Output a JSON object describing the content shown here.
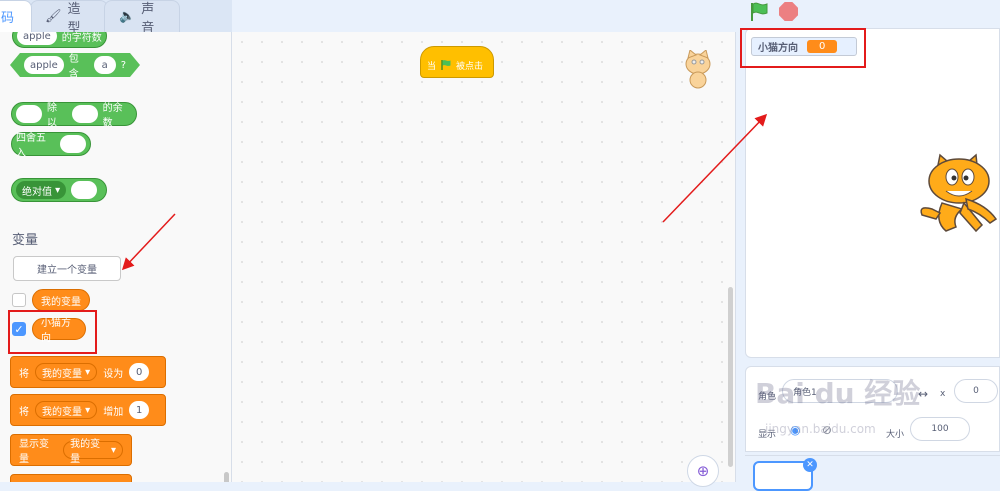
{
  "tabs": {
    "code": "码",
    "costumes": "造型",
    "sounds": "声音"
  },
  "palette": {
    "length_block": {
      "value": "apple",
      "text": "的字符数"
    },
    "contains_block": {
      "value1": "apple",
      "text": "包含",
      "value2": "a",
      "suffix": "?"
    },
    "mod_block": {
      "text1": "除以",
      "text2": "的余数"
    },
    "round_block": {
      "text": "四舍五入"
    },
    "abs_block": {
      "dropdown": "绝对值"
    },
    "section_title": "变量",
    "make_variable": "建立一个变量",
    "variables": [
      "我的变量",
      "小猫方向"
    ],
    "set_block": {
      "prefix": "将",
      "var": "我的变量",
      "action": "设为",
      "value": "0"
    },
    "change_block": {
      "prefix": "将",
      "var": "我的变量",
      "action": "增加",
      "value": "1"
    },
    "show_block": {
      "text": "显示变量",
      "var": "我的变量"
    }
  },
  "script": {
    "hat": {
      "when": "当",
      "clicked": "被点击"
    }
  },
  "stage": {
    "monitor_label": "小猫方向",
    "monitor_value": "0"
  },
  "sprite_info": {
    "sprite_label": "角色",
    "sprite_name": "角色1",
    "x_label": "x",
    "x_value": "0",
    "show_label": "显示",
    "size_label": "大小",
    "size_value": "100"
  },
  "watermark": {
    "main": "Bai du 经验",
    "sub": "jingyan.baidu.com"
  },
  "colors": {
    "looks_orange": "#ff8c1a",
    "operator_green": "#59c059",
    "event_yellow": "#ffbf00",
    "highlight_red": "#e31b1b",
    "accent_blue": "#4c97ff"
  }
}
